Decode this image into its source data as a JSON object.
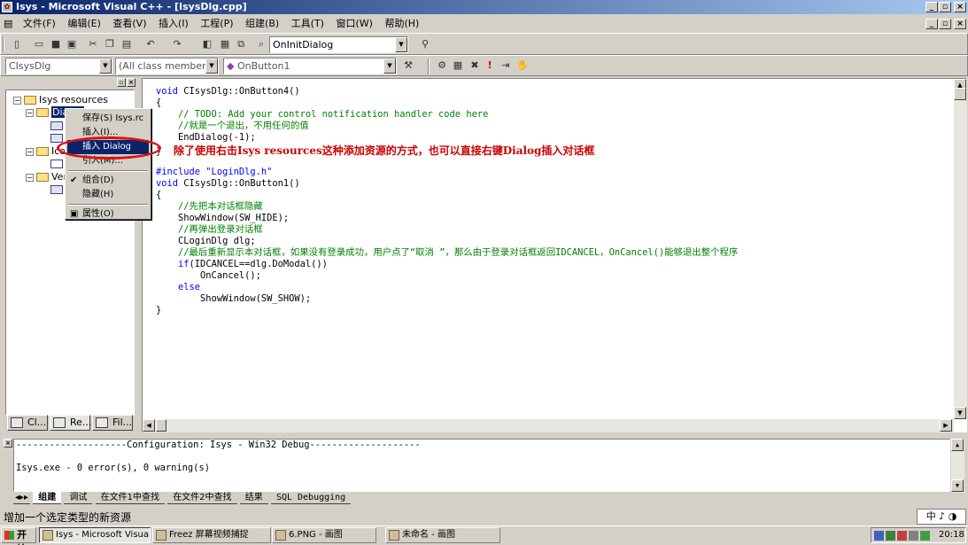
{
  "window": {
    "title": "Isys - Microsoft Visual C++ - [IsysDlg.cpp]"
  },
  "menu": [
    "文件(F)",
    "编辑(E)",
    "查看(V)",
    "插入(I)",
    "工程(P)",
    "组建(B)",
    "工具(T)",
    "窗口(W)",
    "帮助(H)"
  ],
  "toolbar": {
    "function_combo": "OnInitDialog",
    "class_combo": "CIsysDlg",
    "members_combo": "(All class members)",
    "member_combo": "OnButton1"
  },
  "workspace": {
    "tree": {
      "root": "Isys resources",
      "dialog_node": "Dialog",
      "icon_node": "Icon",
      "version_node": "Version"
    },
    "tabs": [
      "Cl...",
      "Re...",
      "Fil..."
    ]
  },
  "context_menu": {
    "items": [
      "保存(S) Isys.rc",
      "插入(I)...",
      "插入 Dialog",
      "引入(M)...",
      "组合(D)",
      "隐藏(H)",
      "属性(O)"
    ],
    "highlighted": "插入 Dialog",
    "checked": "组合(D)"
  },
  "editor": {
    "lines": [
      {
        "t": "void CIsysDlg::OnButton4()",
        "c": "plain"
      },
      {
        "t": "{",
        "c": "plain"
      },
      {
        "t": "    // TODO: Add your control notification handler code here",
        "c": "comment"
      },
      {
        "t": "    //就是一个退出，不用任何的值",
        "c": "comment"
      },
      {
        "t": "    EndDialog(-1);",
        "c": "plain"
      },
      {
        "t": "}",
        "c": "plain"
      },
      {
        "t": "#include \"LoginDlg.h\"",
        "c": "include"
      },
      {
        "t": "void CIsysDlg::OnButton1()",
        "c": "plain"
      },
      {
        "t": "{",
        "c": "plain"
      },
      {
        "t": "    //先把本对话框隐藏",
        "c": "comment"
      },
      {
        "t": "    ShowWindow(SW_HIDE);",
        "c": "plain"
      },
      {
        "t": "    //再弹出登录对话框",
        "c": "comment"
      },
      {
        "t": "    CLoginDlg dlg;",
        "c": "plain"
      },
      {
        "t": "    //最后重新显示本对话框，如果没有登录成功，用户点了“取消 ”，那么由于登录对话框返回IDCANCEL，OnCancel()能够退出整个程序",
        "c": "comment"
      },
      {
        "t": "    if(IDCANCEL==dlg.DoModal())",
        "c": "if"
      },
      {
        "t": "        OnCancel();",
        "c": "plain"
      },
      {
        "t": "    else",
        "c": "else"
      },
      {
        "t": "        ShowWindow(SW_SHOW);",
        "c": "plain"
      },
      {
        "t": "}",
        "c": "plain"
      }
    ],
    "annotation": "除了使用右击Isys resources这种添加资源的方式，也可以直接右键Dialog插入对话框"
  },
  "output": {
    "lines": [
      "--------------------Configuration: Isys - Win32 Debug--------------------",
      "",
      "Isys.exe - 0 error(s), 0 warning(s)"
    ],
    "tabs": [
      "组建",
      "调试",
      "在文件1中查找",
      "在文件2中查找",
      "结果",
      "SQL Debugging"
    ]
  },
  "statusbar": {
    "text": "增加一个选定类型的新资源",
    "ime": "中 ♪ ◑"
  },
  "taskbar": {
    "start": "开始",
    "tasks": [
      "Isys - Microsoft Visual C...",
      "Freez 屏幕视频捕捉",
      "6.PNG - 画图",
      "未命名 - 画图"
    ],
    "clock": "20:18"
  }
}
